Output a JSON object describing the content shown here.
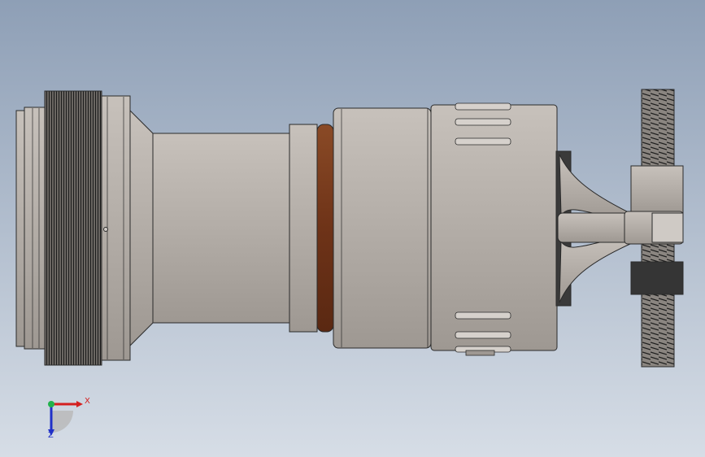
{
  "viewport": {
    "background_top": "#8e9fb6",
    "background_bottom": "#d6dde6",
    "model": "cable-connector-assembly",
    "metal_color": "#b3ada7",
    "gasket_color": "#7a3a1c"
  },
  "triad": {
    "x_label": "X",
    "z_label": "Z",
    "x_color": "#d42020",
    "y_color": "#22b24c",
    "z_color": "#2030c8"
  }
}
